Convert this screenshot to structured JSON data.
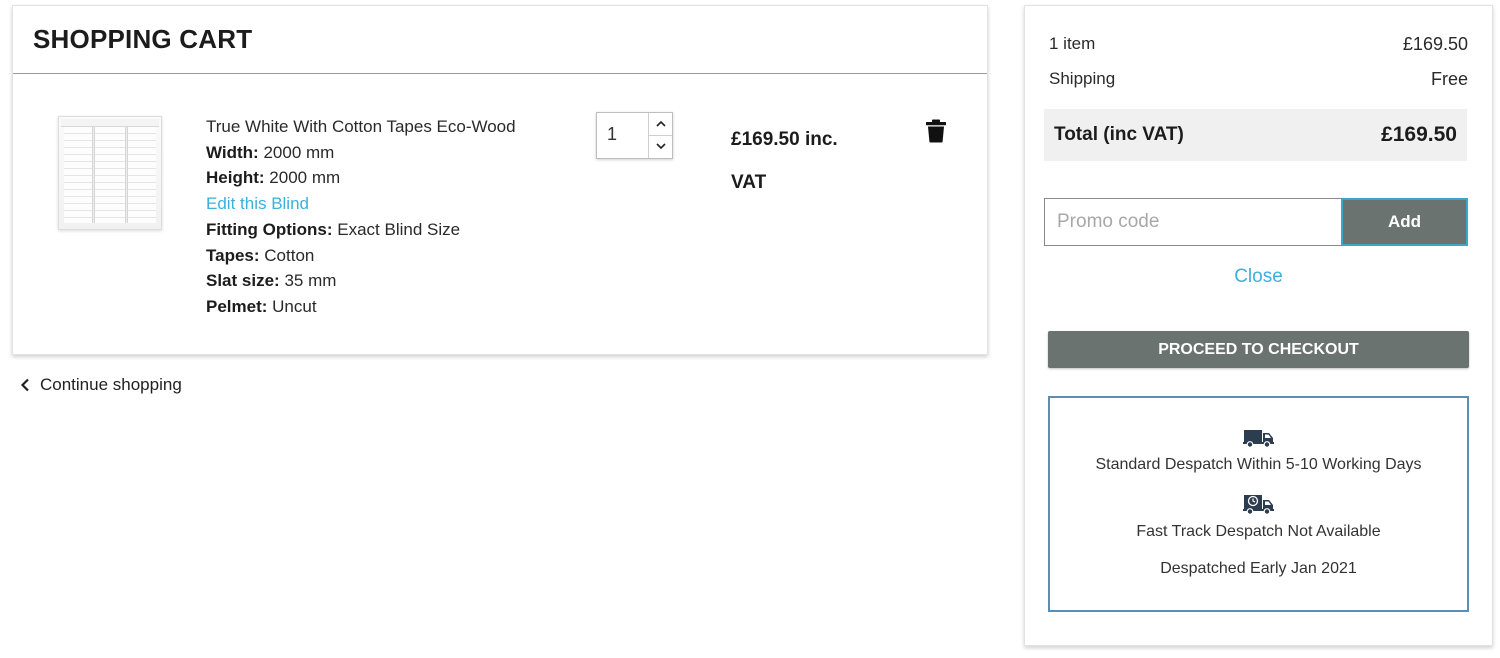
{
  "cart": {
    "title": "SHOPPING CART",
    "item": {
      "name": "True White With Cotton Tapes Eco-Wood",
      "specs": [
        {
          "label": "Width:",
          "value": "2000 mm"
        },
        {
          "label": "Height:",
          "value": "2000 mm"
        }
      ],
      "edit_link": "Edit this Blind",
      "options": [
        {
          "label": "Fitting Options:",
          "value": "Exact Blind Size"
        },
        {
          "label": "Tapes:",
          "value": "Cotton"
        },
        {
          "label": "Slat size:",
          "value": "35 mm"
        },
        {
          "label": "Pelmet:",
          "value": "Uncut"
        }
      ],
      "quantity": "1",
      "price_line1": "£169.50 inc.",
      "price_line2": "VAT",
      "image_icon": "venetian-blind-image",
      "delete_icon": "trash-icon"
    },
    "continue_label": "Continue shopping"
  },
  "summary": {
    "items_label": "1 item",
    "items_value": "£169.50",
    "shipping_label": "Shipping",
    "shipping_value": "Free",
    "total_label": "Total (inc VAT)",
    "total_value": "£169.50",
    "promo_placeholder": "Promo code",
    "promo_button": "Add",
    "close_label": "Close",
    "checkout_label": "PROCEED TO CHECKOUT",
    "despatch": {
      "standard": "Standard Despatch Within 5-10 Working Days",
      "fast_track": "Fast Track Despatch Not Available",
      "date": "Despatched Early Jan 2021"
    }
  },
  "colors": {
    "accent_link": "#3ab0de",
    "button_grey": "#6b7371",
    "despatch_border": "#5c8db5"
  }
}
